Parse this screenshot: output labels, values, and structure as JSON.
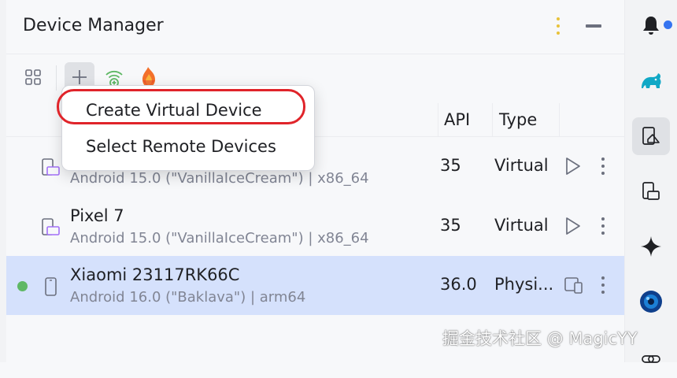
{
  "header": {
    "title": "Device Manager"
  },
  "toolbar": {
    "icons": [
      "grid-icon",
      "add-icon",
      "wifi-pair-icon",
      "firebase-icon"
    ]
  },
  "columns": {
    "api": "API",
    "type": "Type"
  },
  "menu": {
    "items": [
      {
        "label": "Create Virtual Device",
        "highlighted": true
      },
      {
        "label": "Select Remote Devices"
      }
    ]
  },
  "devices": [
    {
      "name": "",
      "os": "Android 15.0 (\"VanillaIceCream\")",
      "sep": " | ",
      "abi": "x86_64",
      "api": "35",
      "type": "Virtual",
      "action": "play-icon",
      "online": false
    },
    {
      "name": "Pixel 7",
      "os": "Android 15.0 (\"VanillaIceCream\")",
      "sep": " | ",
      "abi": "x86_64",
      "api": "35",
      "type": "Virtual",
      "action": "play-icon",
      "online": false
    },
    {
      "name": "Xiaomi 23117RK66C",
      "os": "Android 16.0 (\"Baklava\")",
      "sep": " | ",
      "abi": "arm64",
      "api": "36.0",
      "type": "Physi...",
      "action": "mirror-icon",
      "online": true,
      "selected": true
    }
  ],
  "rail": {
    "icons": [
      "notifications-icon",
      "gradle-icon",
      "device-manager-icon",
      "running-devices-icon",
      "gemini-icon",
      "app-quality-icon",
      "link-icon"
    ]
  },
  "watermark": "掘金技术社区 @ MagicYY",
  "colors": {
    "accent": "#3574f0",
    "selection": "#d5e1fc",
    "highlight_ring": "#e0242a",
    "online": "#5fb865"
  }
}
